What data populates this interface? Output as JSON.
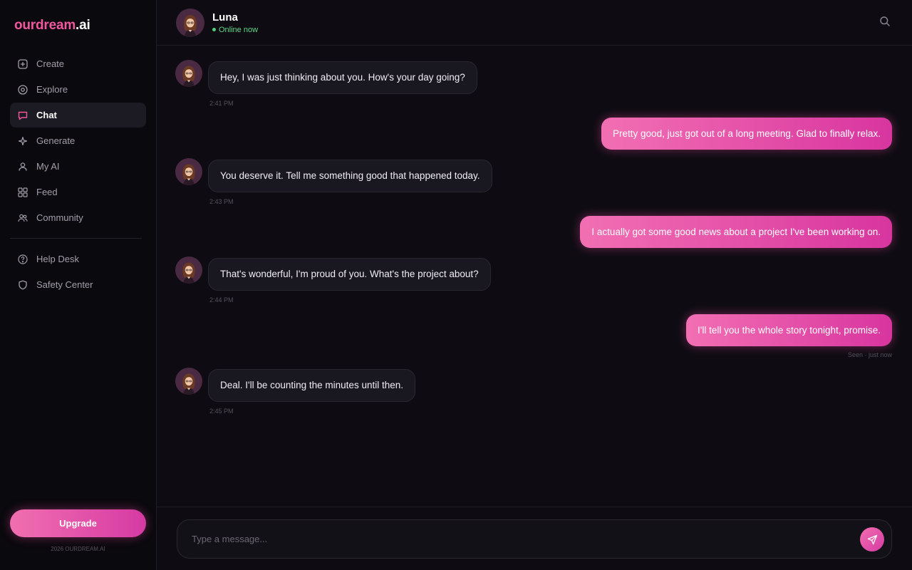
{
  "app": {
    "logo_brand": "ourdream",
    "logo_tld": ".ai",
    "copyright": "2026 OURDREAM.AI",
    "upgrade_label": "Upgrade",
    "accent": "#f0579e"
  },
  "sidebar": {
    "items": [
      {
        "label": "Create",
        "icon": "plus-square-icon"
      },
      {
        "label": "Explore",
        "icon": "compass-icon"
      },
      {
        "label": "Chat",
        "icon": "chat-bubble-icon",
        "active": true
      },
      {
        "label": "Generate",
        "icon": "sparkle-icon"
      },
      {
        "label": "My AI",
        "icon": "user-icon"
      },
      {
        "label": "Feed",
        "icon": "grid-icon"
      },
      {
        "label": "Community",
        "icon": "users-icon"
      }
    ],
    "secondary": [
      {
        "label": "Help Desk",
        "icon": "help-circle-icon"
      },
      {
        "label": "Safety Center",
        "icon": "shield-icon"
      }
    ]
  },
  "header": {
    "name": "Luna",
    "status": "Online now"
  },
  "messages": [
    {
      "from": "ai",
      "text": "Hey, I was just thinking about you. How's your day going?",
      "time": "2:41 PM"
    },
    {
      "from": "user",
      "text": "Pretty good, just got out of a long meeting. Glad to finally relax."
    },
    {
      "from": "ai",
      "text": "You deserve it. Tell me something good that happened today.",
      "time": "2:43 PM"
    },
    {
      "from": "user",
      "text": "I actually got some good news about a project I've been working on."
    },
    {
      "from": "ai",
      "text": "That's wonderful, I'm proud of you. What's the project about?",
      "time": "2:44 PM"
    },
    {
      "from": "user",
      "text": "I'll tell you the whole story tonight, promise."
    },
    {
      "from": "ai",
      "text": "Deal. I'll be counting the minutes until then.",
      "time": "2:45 PM"
    }
  ],
  "seen_status": "Seen · just now",
  "composer": {
    "placeholder": "Type a message..."
  }
}
